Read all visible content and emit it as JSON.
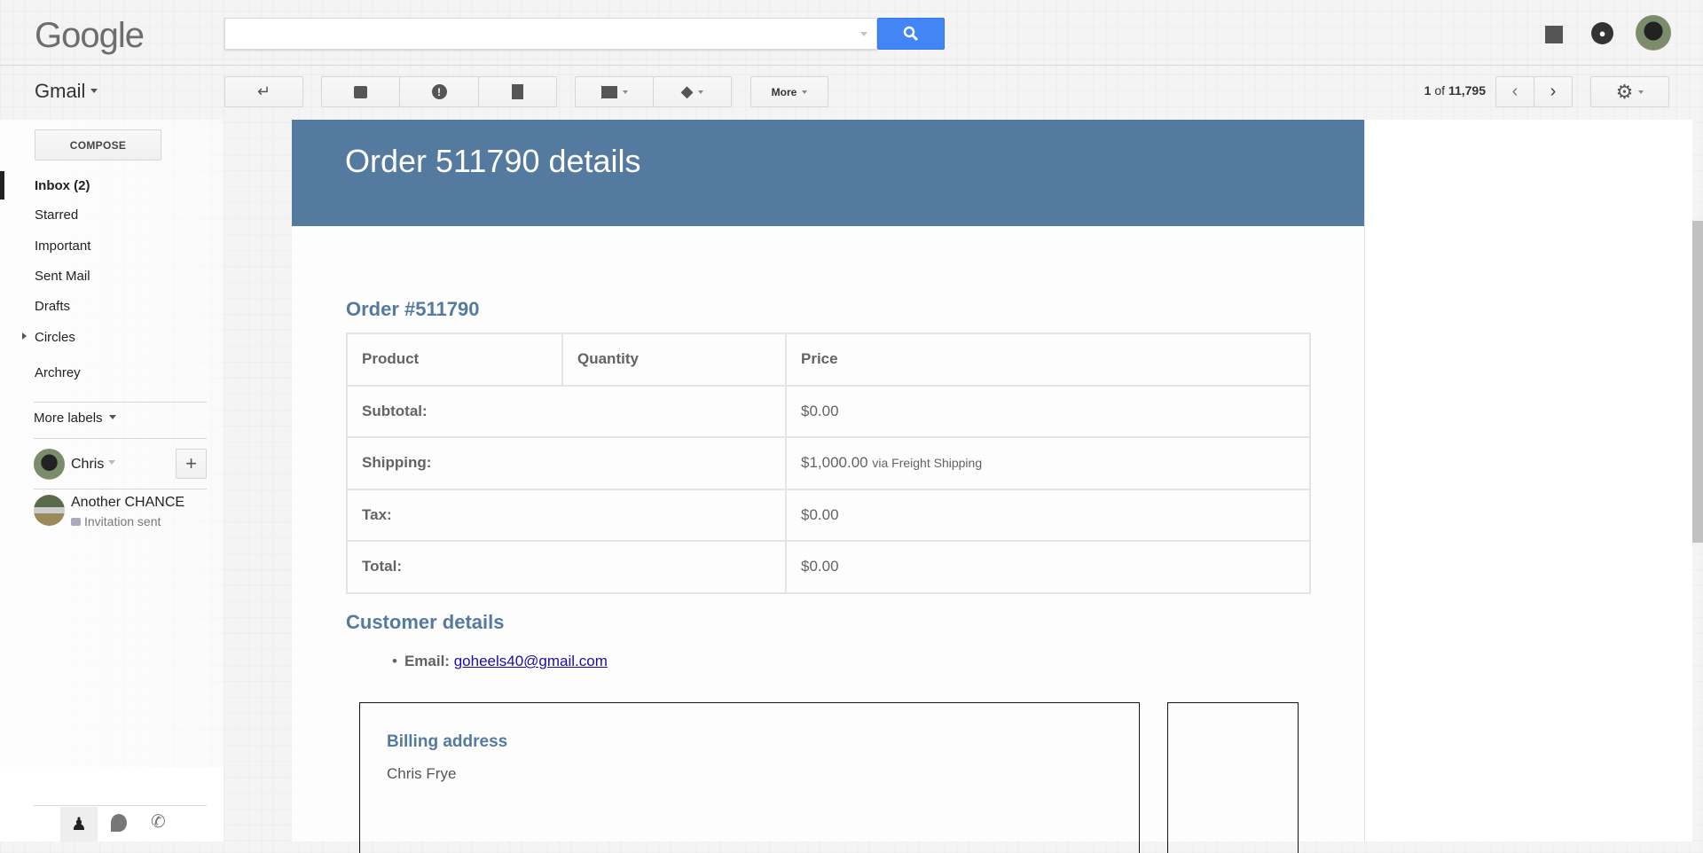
{
  "header": {
    "logo": "Google",
    "search_placeholder": "",
    "pagination": {
      "current": "1",
      "of": "of",
      "total": "11,795"
    }
  },
  "toolbar": {
    "app_label": "Gmail",
    "more_label": "More"
  },
  "sidebar": {
    "compose": "COMPOSE",
    "items": [
      {
        "label": "Inbox (2)"
      },
      {
        "label": "Starred"
      },
      {
        "label": "Important"
      },
      {
        "label": "Sent Mail"
      },
      {
        "label": "Drafts"
      },
      {
        "label": "Circles"
      },
      {
        "label": "Archrey"
      }
    ],
    "more_labels": "More labels",
    "hangouts": {
      "user": "Chris",
      "contact_name": "Another CHANCE",
      "contact_status": "Invitation sent"
    }
  },
  "email": {
    "title": "Order 511790 details",
    "order_heading": "Order #511790",
    "table": {
      "headers": [
        "Product",
        "Quantity",
        "Price"
      ],
      "rows": [
        {
          "label": "Subtotal:",
          "value": "$0.00",
          "note": ""
        },
        {
          "label": "Shipping:",
          "value": "$1,000.00",
          "note": "via Freight Shipping"
        },
        {
          "label": "Tax:",
          "value": "$0.00",
          "note": ""
        },
        {
          "label": "Total:",
          "value": "$0.00",
          "note": ""
        }
      ]
    },
    "customer_heading": "Customer details",
    "email_label": "Email:",
    "email_value": "goheels40@gmail.com",
    "billing_heading": "Billing address",
    "billing_name": "Chris Frye"
  },
  "colors": {
    "accent": "#557a9f",
    "search_button": "#4285f4",
    "link": "#1a0dab"
  }
}
